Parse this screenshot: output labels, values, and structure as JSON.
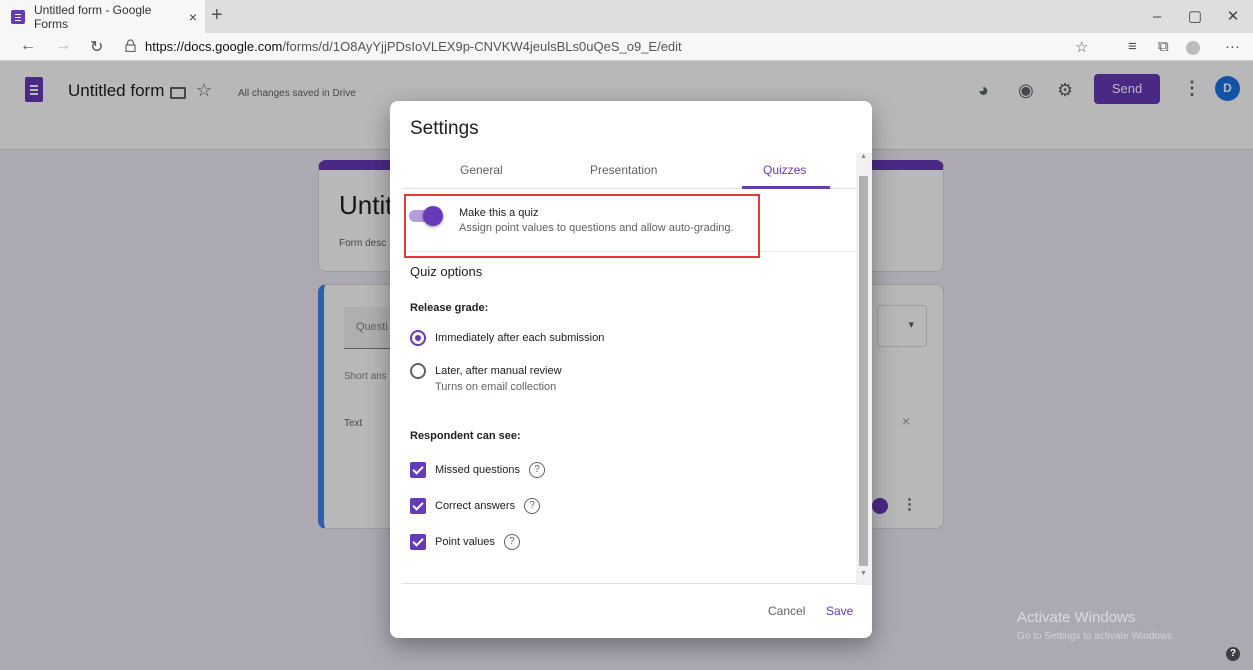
{
  "browser": {
    "tab_title": "Untitled form - Google Forms",
    "tab_close": "×",
    "new_tab": "+",
    "url_host": "https://docs.google.com",
    "url_path": "/forms/d/1O8AyYjjPDsIoVLEX9p-CNVKW4jeulsBLs0uQeS_o9_E/edit",
    "icons": [
      "back-icon",
      "forward-icon",
      "refresh-icon",
      "lock-icon",
      "favorite-star-icon",
      "collections-icon",
      "extensions-icon",
      "profile-icon",
      "more-icon"
    ]
  },
  "forms_header": {
    "title": "Untitled form",
    "saved_status": "All changes saved in Drive",
    "send_label": "Send",
    "avatar_letter": "D",
    "accent": "#673ab7"
  },
  "form_body": {
    "title_partial": "Untit",
    "desc_partial": "Form desc",
    "question_partial": "Questi",
    "answer_type_partial": "Short ans",
    "option_text": "Text"
  },
  "dialog": {
    "title": "Settings",
    "tabs": [
      {
        "label": "General",
        "active": false
      },
      {
        "label": "Presentation",
        "active": false
      },
      {
        "label": "Quizzes",
        "active": true
      }
    ],
    "quiz_toggle": {
      "label": "Make this a quiz",
      "description": "Assign point values to questions and allow auto-grading.",
      "enabled": true
    },
    "quiz_options_heading": "Quiz options",
    "release_grade": {
      "heading": "Release grade:",
      "options": [
        {
          "label": "Immediately after each submission",
          "selected": true
        },
        {
          "label": "Later, after manual review",
          "sublabel": "Turns on email collection",
          "selected": false
        }
      ]
    },
    "respondent_can_see": {
      "heading": "Respondent can see:",
      "options": [
        {
          "label": "Missed questions",
          "checked": true
        },
        {
          "label": "Correct answers",
          "checked": true
        },
        {
          "label": "Point values",
          "checked": true
        }
      ]
    },
    "cancel_label": "Cancel",
    "save_label": "Save"
  },
  "watermark": {
    "line1": "Activate Windows",
    "line2": "Go to Settings to activate Windows."
  }
}
